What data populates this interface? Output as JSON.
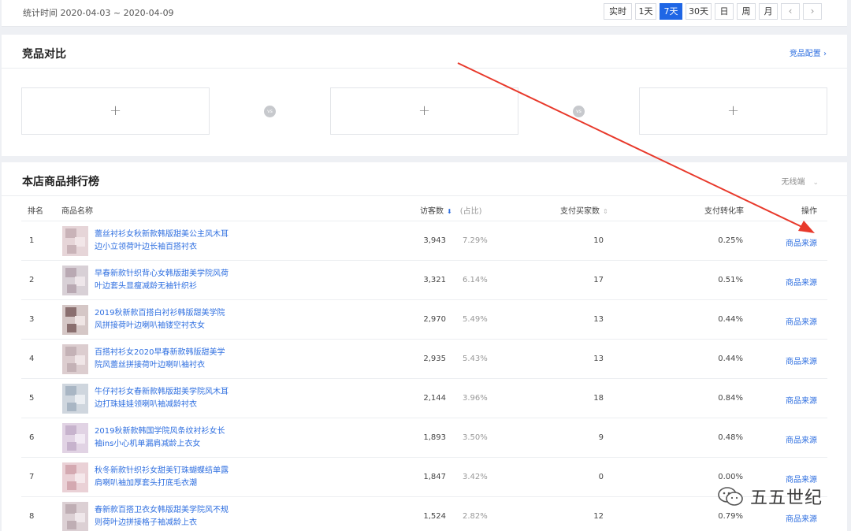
{
  "header": {
    "stat_time": "统计时间 2020-04-03 ~ 2020-04-09",
    "ranges": [
      {
        "label": "实时",
        "active": false
      },
      {
        "label": "1天",
        "active": false
      },
      {
        "label": "7天",
        "active": true
      },
      {
        "label": "30天",
        "active": false
      },
      {
        "label": "日",
        "active": false
      },
      {
        "label": "周",
        "active": false
      },
      {
        "label": "月",
        "active": false
      }
    ],
    "prev_icon": "‹",
    "next_icon": "›"
  },
  "compare": {
    "title": "竞品对比",
    "config_link": "竞品配置 ›",
    "slot_symbol": "+",
    "vs_label": "vs"
  },
  "ranking": {
    "title": "本店商品排行榜",
    "terminal": "无线端",
    "terminal_chevron": "⌄",
    "columns": {
      "rank": "排名",
      "name": "商品名称",
      "visitors": "访客数",
      "visitors_sort": "⬇",
      "share": "(占比)",
      "buyers": "支付买家数",
      "buyers_sort": "⇕",
      "conversion": "支付转化率",
      "action": "操作"
    },
    "rows": [
      {
        "rank": "1",
        "name": "蕾丝衬衫女秋新款韩版甜美公主风木耳边小立领荷叶边长袖百搭衬衣",
        "visitors": "3,943",
        "share": "7.29%",
        "buyers": "10",
        "conversion": "0.25%",
        "action": "商品来源"
      },
      {
        "rank": "2",
        "name": "早春新款针织背心女韩版甜美学院风荷叶边套头显瘦减龄无袖针织衫",
        "visitors": "3,321",
        "share": "6.14%",
        "buyers": "17",
        "conversion": "0.51%",
        "action": "商品来源"
      },
      {
        "rank": "3",
        "name": "2019秋新款百搭白衬衫韩版甜美学院风拼接荷叶边喇叭袖镂空衬衣女",
        "visitors": "2,970",
        "share": "5.49%",
        "buyers": "13",
        "conversion": "0.44%",
        "action": "商品来源"
      },
      {
        "rank": "4",
        "name": "百搭衬衫女2020早春新款韩版甜美学院风蕾丝拼接荷叶边喇叭袖衬衣",
        "visitors": "2,935",
        "share": "5.43%",
        "buyers": "13",
        "conversion": "0.44%",
        "action": "商品来源"
      },
      {
        "rank": "5",
        "name": "牛仔衬衫女春新款韩版甜美学院风木耳边打珠娃娃领喇叭袖减龄衬衣",
        "visitors": "2,144",
        "share": "3.96%",
        "buyers": "18",
        "conversion": "0.84%",
        "action": "商品来源"
      },
      {
        "rank": "6",
        "name": "2019秋新款韩国学院风条纹衬衫女长袖ins小心机单漏肩减龄上衣女",
        "visitors": "1,893",
        "share": "3.50%",
        "buyers": "9",
        "conversion": "0.48%",
        "action": "商品来源"
      },
      {
        "rank": "7",
        "name": "秋冬新款针织衫女甜美钉珠蝴蝶结单露肩喇叭袖加厚套头打底毛衣潮",
        "visitors": "1,847",
        "share": "3.42%",
        "buyers": "0",
        "conversion": "0.00%",
        "action": "商品来源"
      },
      {
        "rank": "8",
        "name": "春新款百搭卫衣女韩版甜美学院风不规则荷叶边拼接格子袖减龄上衣",
        "visitors": "1,524",
        "share": "2.82%",
        "buyers": "12",
        "conversion": "0.79%",
        "action": "商品来源"
      }
    ]
  },
  "watermark": {
    "text": "五五世纪",
    "icon": "wechat-icon"
  },
  "colors": {
    "accent": "#1f66e5",
    "link": "#2f6fe0",
    "arrow": "#e8392b"
  }
}
